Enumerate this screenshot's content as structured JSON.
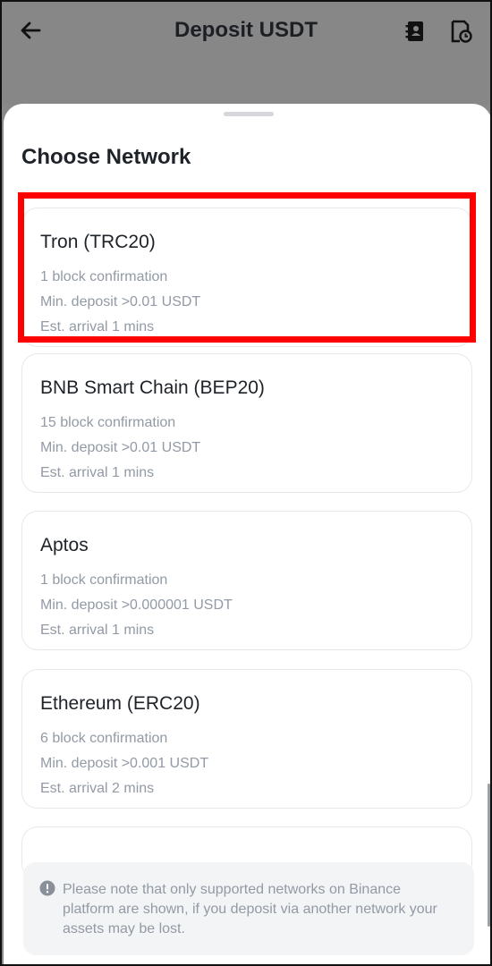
{
  "header": {
    "title": "Deposit USDT",
    "back_icon": "arrow-left-icon",
    "right_icons": [
      "address-book-icon",
      "history-icon"
    ]
  },
  "sheet": {
    "title": "Choose Network"
  },
  "networks": [
    {
      "name": "Tron (TRC20)",
      "confirmation": "1 block confirmation",
      "min_deposit": "Min. deposit >0.01 USDT",
      "arrival": "Est. arrival 1 mins",
      "highlighted": true
    },
    {
      "name": "BNB Smart Chain (BEP20)",
      "confirmation": "15 block confirmation",
      "min_deposit": "Min. deposit >0.01 USDT",
      "arrival": "Est. arrival 1 mins"
    },
    {
      "name": "Aptos",
      "confirmation": "1 block confirmation",
      "min_deposit": "Min. deposit >0.000001 USDT",
      "arrival": "Est. arrival 1 mins"
    },
    {
      "name": "Ethereum (ERC20)",
      "confirmation": "6 block confirmation",
      "min_deposit": "Min. deposit >0.001 USDT",
      "arrival": "Est. arrival 2 mins"
    }
  ],
  "notice": {
    "icon": "info-circle-icon",
    "text": "Please note that only supported networks on Binance platform are shown, if you deposit via another network your assets may be lost."
  },
  "colors": {
    "highlight": "#ff0000",
    "header_bg": "#878787",
    "muted_text": "#929aa5"
  }
}
